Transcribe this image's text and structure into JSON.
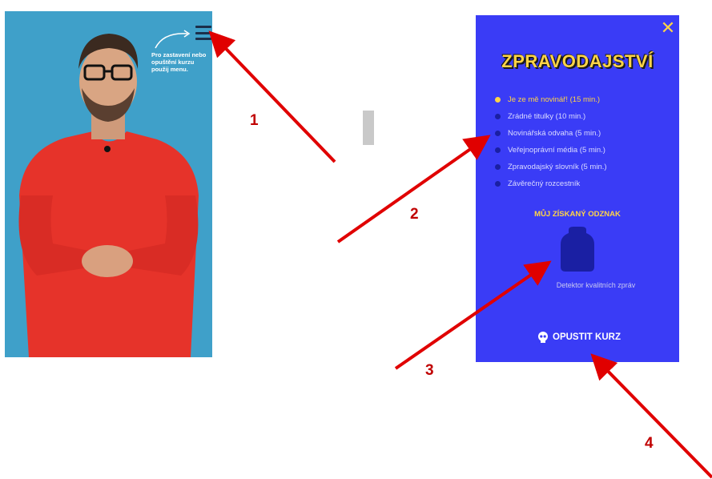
{
  "left_screen": {
    "hint_text": "Pro zastavení nebo opuštění kurzu použij menu."
  },
  "menu": {
    "title": "ZPRAVODAJSTVÍ",
    "chapters": [
      {
        "label": "Je ze mě novinář! (15 min.)",
        "active": true
      },
      {
        "label": "Zrádné titulky (10 min.)",
        "active": false
      },
      {
        "label": "Novinářská odvaha (5 min.)",
        "active": false
      },
      {
        "label": "Veřejnoprávní média (5 min.)",
        "active": false
      },
      {
        "label": "Zpravodajský slovník (5 min.)",
        "active": false
      },
      {
        "label": "Závěrečný rozcestník",
        "active": false
      }
    ],
    "badge_title": "MŮJ ZÍSKANÝ ODZNAK",
    "badge_label": "Detektor kvalitních zpráv",
    "leave_label": "OPUSTIT KURZ"
  },
  "annotations": {
    "labels": [
      "1",
      "2",
      "3",
      "4"
    ]
  },
  "colors": {
    "menu_bg": "#3a3cf6",
    "accent_yellow": "#ffd447",
    "left_bg": "#3fa0c9",
    "arrow_red": "#e00000"
  }
}
